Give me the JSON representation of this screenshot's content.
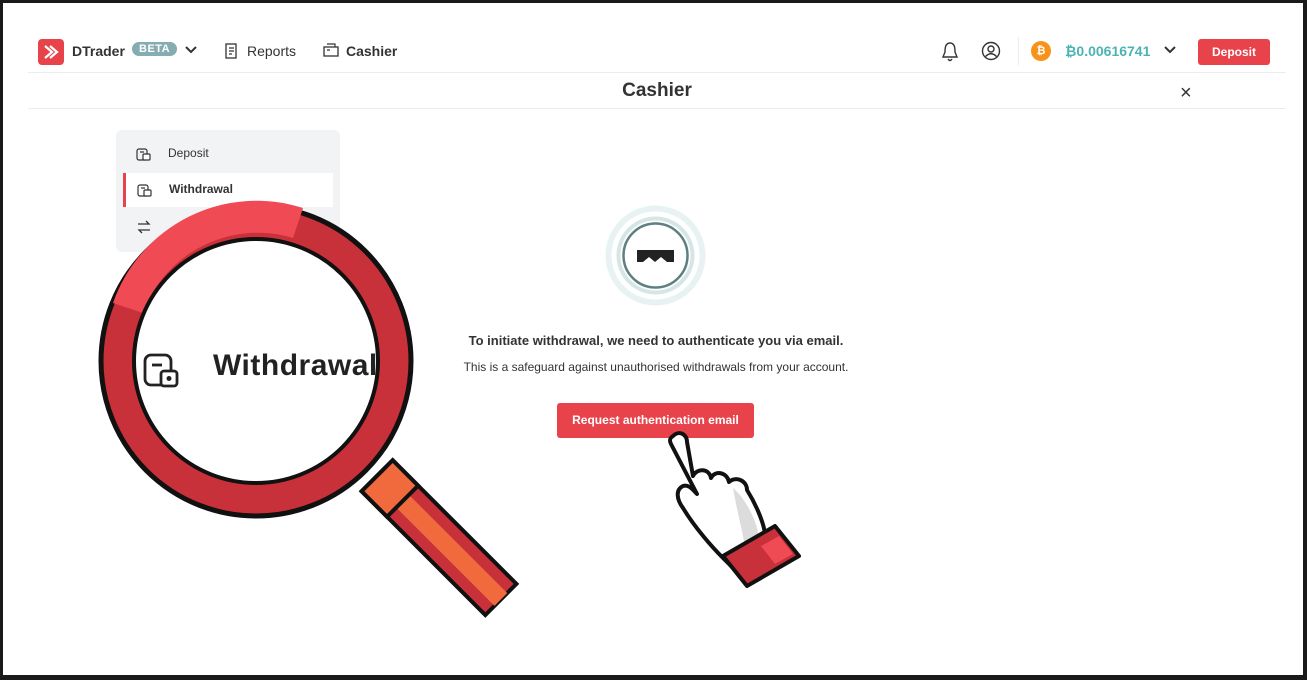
{
  "header": {
    "brand": "DTrader",
    "badge": "BETA",
    "nav": [
      {
        "label": "Reports",
        "icon": "reports-icon"
      },
      {
        "label": "Cashier",
        "icon": "cashier-icon"
      }
    ],
    "currency_symbol": "₿",
    "balance": "₿0.00616741",
    "deposit_label": "Deposit"
  },
  "cashier": {
    "title": "Cashier",
    "close": "×"
  },
  "sidebar": {
    "items": [
      {
        "label": "Deposit",
        "icon": "deposit-icon"
      },
      {
        "label": "Withdrawal",
        "icon": "withdrawal-icon",
        "active": true
      },
      {
        "label": "",
        "icon": "transfer-icon"
      }
    ]
  },
  "main": {
    "message_title": "To initiate withdrawal, we need to authenticate you via email.",
    "message_sub": "This is a safeguard against unauthorised withdrawals from your account.",
    "button_label": "Request authentication email"
  },
  "magnifier": {
    "label": "Withdrawal"
  },
  "colors": {
    "accent": "#e8424b",
    "balance": "#4bb4b3",
    "badge": "#85acb0",
    "btc": "#f7931a"
  }
}
